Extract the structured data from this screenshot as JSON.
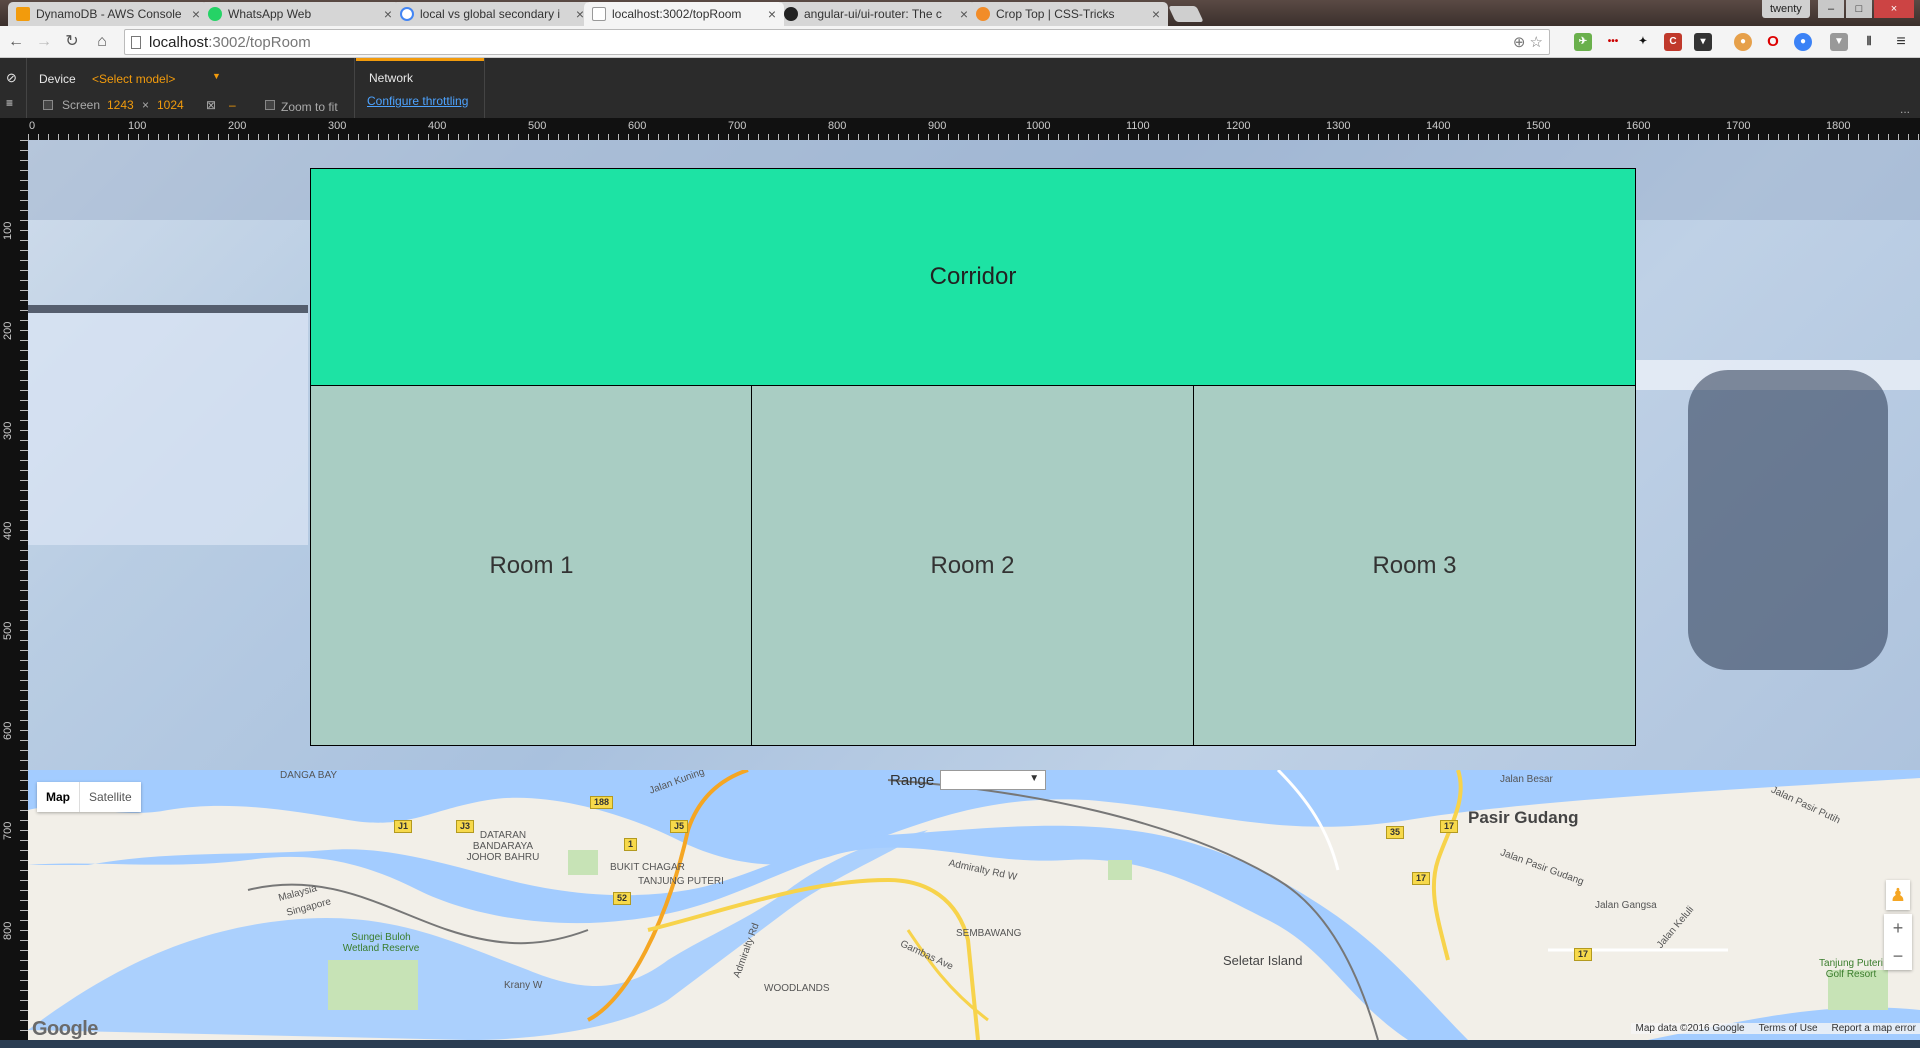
{
  "browser": {
    "tabs": [
      {
        "label": "DynamoDB - AWS Console",
        "icon": "aws-icon",
        "color": "#f29b0c"
      },
      {
        "label": "WhatsApp Web",
        "icon": "whatsapp-icon",
        "color": "#25d366"
      },
      {
        "label": "local vs global secondary i",
        "icon": "google-icon",
        "color": "#4285f4"
      },
      {
        "label": "localhost:3002/topRoom",
        "icon": "page-icon",
        "color": "#999999"
      },
      {
        "label": "angular-ui/ui-router: The c",
        "icon": "github-icon",
        "color": "#222222"
      },
      {
        "label": "Crop Top | CSS-Tricks",
        "icon": "csstricks-icon",
        "color": "#f28c28"
      }
    ],
    "profile_name": "twenty",
    "address": {
      "host": "localhost",
      "path": ":3002/topRoom"
    }
  },
  "devtools": {
    "device_label": "Device",
    "model_select": "<Select model>",
    "network_label": "Network",
    "screen_label": "Screen",
    "screen_width": "1243",
    "times": "×",
    "screen_height": "1024",
    "dash": "–",
    "zoom_to_fit": "Zoom to fit",
    "configure_throttling": "Configure throttling",
    "more": "..."
  },
  "ruler": {
    "top": [
      "0",
      "100",
      "200",
      "300",
      "400",
      "500",
      "600",
      "700",
      "800",
      "900",
      "1000",
      "1100",
      "1200",
      "1300",
      "1400",
      "1500",
      "1600",
      "1700",
      "1800"
    ],
    "left": [
      "100",
      "200",
      "300",
      "400",
      "500",
      "600",
      "700",
      "800"
    ]
  },
  "floor": {
    "corridor": "Corridor",
    "rooms": [
      "Room 1",
      "Room 2",
      "Room 3"
    ]
  },
  "map": {
    "type_map": "Map",
    "type_satellite": "Satellite",
    "range_label": "Range",
    "places": [
      "DANGA BAY",
      "Jalan Kuning",
      "DATARAN BANDARAYA JOHOR BAHRU",
      "BUKIT CHAGAR",
      "TANJUNG PUTERI",
      "Malaysia",
      "Singapore",
      "Admiralty Rd W",
      "SEMBAWANG",
      "Gambas Ave",
      "Admiralty Rd",
      "Sungei Buloh Wetland Reserve",
      "WOODLANDS",
      "Krany W",
      "Jalan Besar",
      "Jalan Pasir Putih",
      "Jalan Pasir Gudang",
      "Jalan Gangsa",
      "Jalan Keluli",
      "Seletar Island",
      "Tanjung Puteri Golf Resort"
    ],
    "big_place": "Pasir Gudang",
    "shields": [
      "188",
      "J1",
      "J3",
      "J5",
      "1",
      "52",
      "35",
      "17",
      "17",
      "17"
    ],
    "google": "Google",
    "attribution": [
      "Map data ©2016 Google",
      "Terms of Use",
      "Report a map error"
    ]
  },
  "colors": {
    "corridor": "#1de3a4",
    "room": "#a9cdc3",
    "water": "#a3ccff"
  }
}
